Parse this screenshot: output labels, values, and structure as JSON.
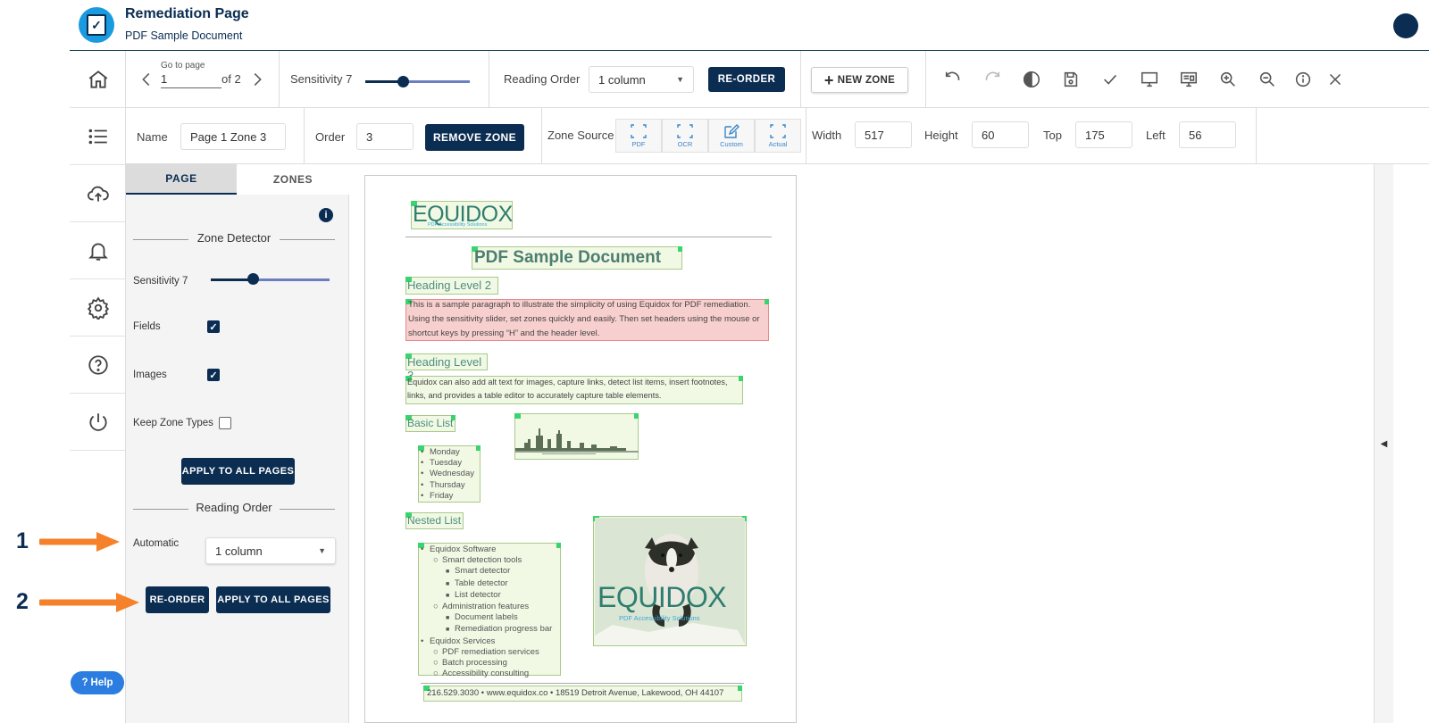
{
  "header": {
    "title": "Remediation Page",
    "subtitle": "PDF Sample Document"
  },
  "toolbar1": {
    "goto_label": "Go to page",
    "page_value": "1",
    "of_label": "of 2",
    "sensitivity_label": "Sensitivity 7",
    "sensitivity_level": 0.4,
    "reading_order_label": "Reading Order",
    "reading_order_value": "1 column",
    "reorder_label": "RE-ORDER",
    "new_zone_label": "NEW ZONE"
  },
  "toolbar2": {
    "name_label": "Name",
    "name_value": "Page 1 Zone 3",
    "order_label": "Order",
    "order_value": "3",
    "remove_zone_label": "REMOVE ZONE",
    "zone_source_label": "Zone Source",
    "sources": [
      "PDF",
      "OCR",
      "Custom",
      "Actual"
    ],
    "width_label": "Width",
    "width_value": "517",
    "height_label": "Height",
    "height_value": "60",
    "top_label": "Top",
    "top_value": "175",
    "left_label": "Left",
    "left_value": "56"
  },
  "left_panel": {
    "tabs": [
      "PAGE",
      "ZONES"
    ],
    "zone_detector_title": "Zone Detector",
    "sensitivity_label": "Sensitivity 7",
    "sensitivity_level": 0.36,
    "fields_label": "Fields",
    "fields_checked": true,
    "images_label": "Images",
    "images_checked": true,
    "keep_zone_types_label": "Keep Zone Types",
    "keep_zone_types_checked": false,
    "apply_all_label": "APPLY TO ALL PAGES",
    "reading_order_title": "Reading Order",
    "automatic_label": "Automatic",
    "automatic_value": "1 column",
    "reorder_label": "RE-ORDER",
    "apply_all_label_2": "APPLY TO ALL PAGES"
  },
  "help_label": "Help",
  "annotations": [
    "1",
    "2"
  ],
  "document": {
    "logo_text": "EQUIDOX",
    "logo_sub": "PDF Accessibility Solutions",
    "title": "PDF Sample Document",
    "h2": "Heading Level 2",
    "para1_lines": [
      "This is a sample paragraph to illustrate the simplicity of using Equidox for PDF remediation.",
      "Using the sensitivity slider, set zones quickly and easily.  Then set headers using the mouse or",
      "shortcut keys by pressing “H” and the header level."
    ],
    "h3": "Heading Level 3",
    "para2_lines": [
      "Equidox can also add alt text for images, capture links, detect list items, insert footnotes,",
      "links, and provides a table editor to accurately capture table elements."
    ],
    "basic_list_heading": "Basic List",
    "basic_list": [
      "Monday",
      "Tuesday",
      "Wednesday",
      "Thursday",
      "Friday"
    ],
    "nested_list_heading": "Nested List",
    "nested_list": [
      {
        "level": 0,
        "text": "Equidox Software"
      },
      {
        "level": 1,
        "text": "Smart detection tools"
      },
      {
        "level": 2,
        "text": "Smart detector"
      },
      {
        "level": 2,
        "text": "Table detector"
      },
      {
        "level": 2,
        "text": "List detector"
      },
      {
        "level": 1,
        "text": "Administration features"
      },
      {
        "level": 2,
        "text": "Document labels"
      },
      {
        "level": 2,
        "text": "Remediation progress bar"
      },
      {
        "level": 0,
        "text": "Equidox Services"
      },
      {
        "level": 1,
        "text": "PDF remediation services"
      },
      {
        "level": 1,
        "text": "Batch processing"
      },
      {
        "level": 1,
        "text": "Accessibility consulting"
      }
    ],
    "image_logo_text": "EQUIDOX",
    "image_logo_sub": "PDF Accessibility Solutions",
    "footer": "216.529.3030 • www.equidox.co • 18519 Detroit Avenue, Lakewood, OH 44107"
  },
  "colors": {
    "navy": "#0b2d52",
    "accent_blue": "#1a9be0",
    "zone_green": "#f1f9e4",
    "zone_red": "#f8cfcf",
    "arrow_orange": "#f5822a"
  }
}
